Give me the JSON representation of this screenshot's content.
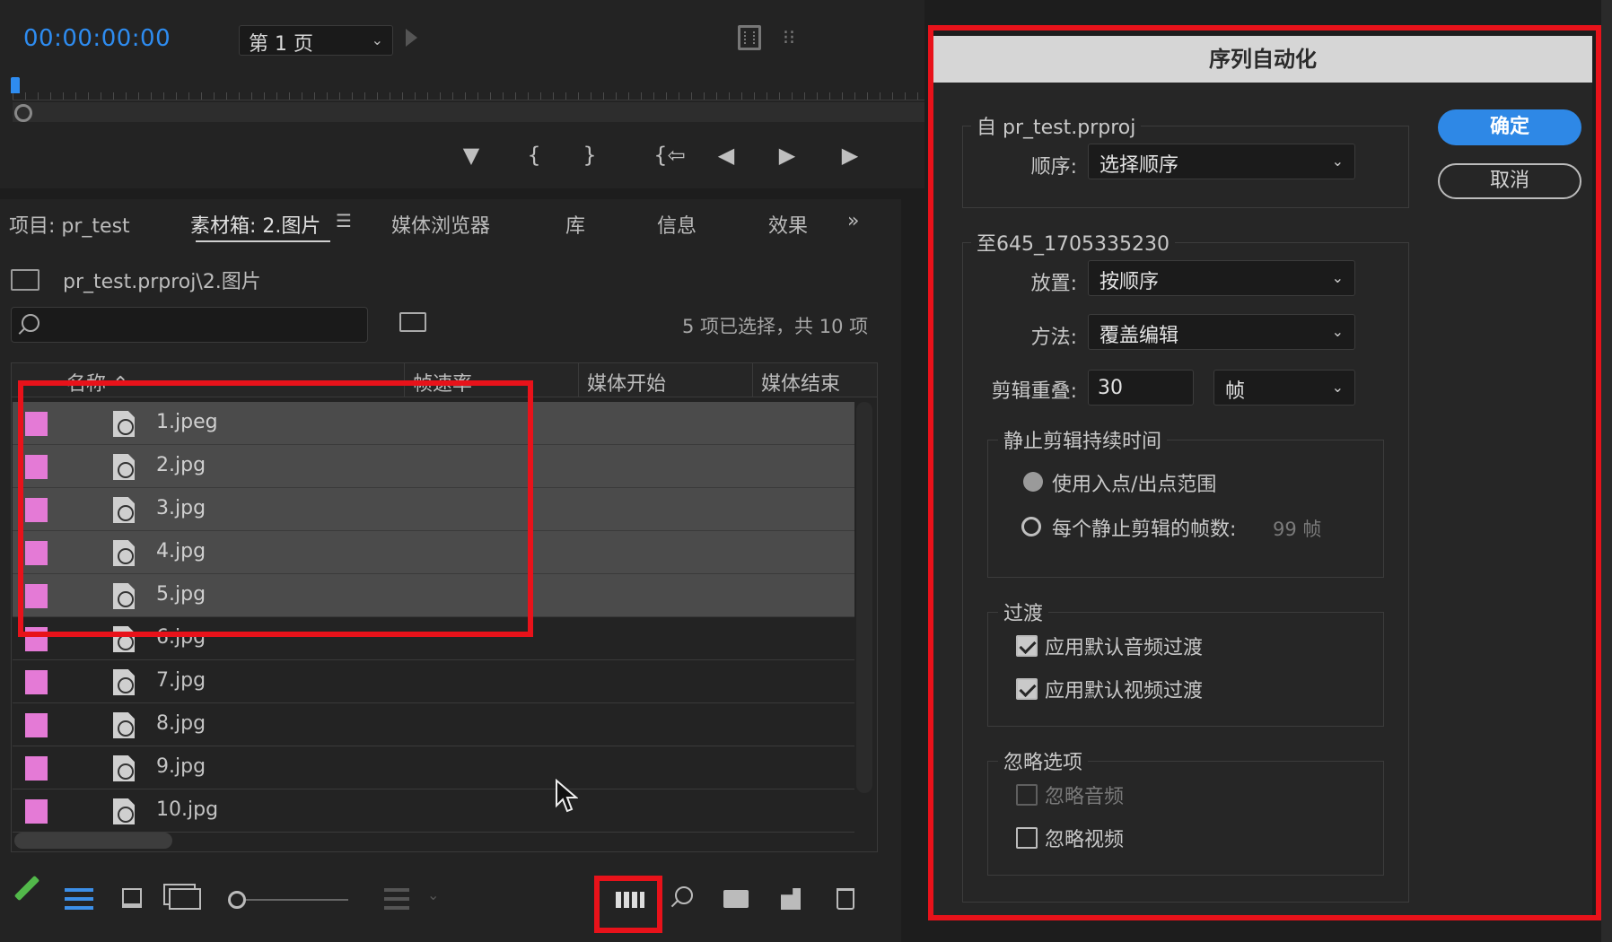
{
  "monitor": {
    "timecode": "00:00:00:00",
    "page_select": "第 1 页"
  },
  "project_panel": {
    "tabs": [
      "项目: pr_test",
      "素材箱: 2.图片",
      "媒体浏览器",
      "库",
      "信息",
      "效果"
    ],
    "active_tab": "素材箱: 2.图片",
    "path": "pr_test.prproj\\2.图片",
    "search": {
      "placeholder": "",
      "value": ""
    },
    "selection_status": "5 项已选择，共 10 项",
    "columns": [
      "名称",
      "帧速率",
      "媒体开始",
      "媒体结束"
    ],
    "label_color": "#e47ad6",
    "items": [
      {
        "name": "1.jpeg",
        "selected": true
      },
      {
        "name": "2.jpg",
        "selected": true
      },
      {
        "name": "3.jpg",
        "selected": true
      },
      {
        "name": "4.jpg",
        "selected": true
      },
      {
        "name": "5.jpg",
        "selected": true
      },
      {
        "name": "6.jpg",
        "selected": false
      },
      {
        "name": "7.jpg",
        "selected": false
      },
      {
        "name": "8.jpg",
        "selected": false
      },
      {
        "name": "9.jpg",
        "selected": false
      },
      {
        "name": "10.jpg",
        "selected": false
      }
    ]
  },
  "dialog": {
    "title": "序列自动化",
    "from_group": "自 pr_test.prproj",
    "order_label": "顺序:",
    "order_value": "选择顺序",
    "to_group": "至645_1705335230",
    "placement_label": "放置:",
    "placement_value": "按顺序",
    "method_label": "方法:",
    "method_value": "覆盖编辑",
    "overlap_label": "剪辑重叠:",
    "overlap_value": "30",
    "overlap_unit": "帧",
    "still_group": "静止剪辑持续时间",
    "still_opt1": "使用入点/出点范围",
    "still_opt2": "每个静止剪辑的帧数:",
    "still_frames": "99 帧",
    "transition_group": "过渡",
    "transition_audio": "应用默认音频过渡",
    "transition_video": "应用默认视频过渡",
    "ignore_group": "忽略选项",
    "ignore_audio": "忽略音频",
    "ignore_video": "忽略视频",
    "ok": "确定",
    "cancel": "取消"
  },
  "colors": {
    "accent": "#2e88e6",
    "highlight": "#e8121a",
    "timecode": "#2e8cf0"
  }
}
